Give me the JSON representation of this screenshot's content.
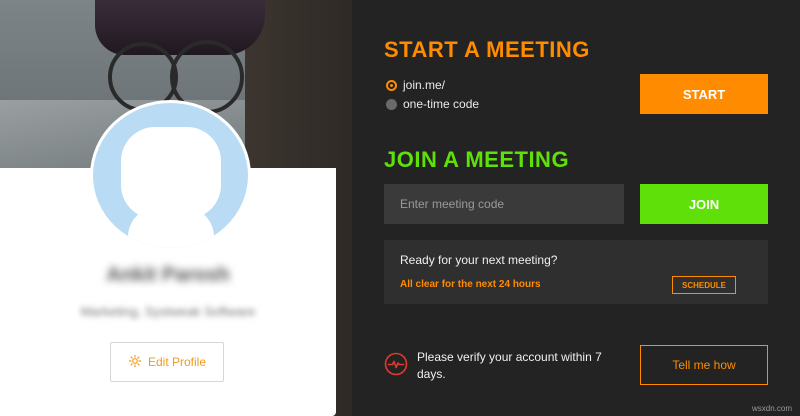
{
  "colors": {
    "accent_orange": "#ff8c00",
    "accent_green": "#5fe008",
    "panel_bg": "#232323",
    "avatar_bg": "#b9dcf4"
  },
  "profile": {
    "name": "Ankit Parosh",
    "subtitle": "Marketing, Systweak Software",
    "edit_label": "Edit Profile",
    "edit_icon": "gear-icon"
  },
  "start_meeting": {
    "heading": "START A MEETING",
    "options": [
      {
        "label": "join.me/",
        "selected": true
      },
      {
        "label": "one-time code",
        "selected": false
      }
    ],
    "button_label": "START"
  },
  "join_meeting": {
    "heading": "JOIN A MEETING",
    "input_placeholder": "Enter meeting code",
    "button_label": "JOIN"
  },
  "next_meeting": {
    "title": "Ready for your next meeting?",
    "status": "All clear for the next 24 hours",
    "schedule_label": "SCHEDULE"
  },
  "verify": {
    "icon": "heartbeat-icon",
    "message": "Please verify your account within 7 days.",
    "button_label": "Tell me how"
  },
  "watermark": "wsxdn.com"
}
